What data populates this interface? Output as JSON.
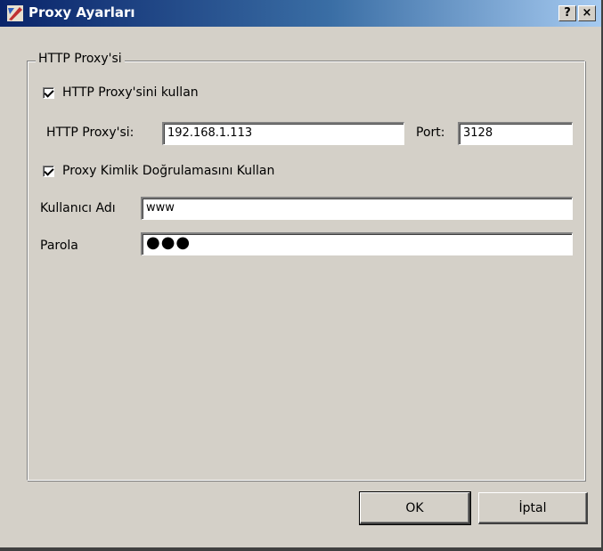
{
  "window": {
    "title": "Proxy Ayarları",
    "help_label": "?",
    "close_label": "×"
  },
  "group": {
    "legend": "HTTP Proxy'si"
  },
  "use_proxy": {
    "label": "HTTP Proxy'sini kullan",
    "checked": true
  },
  "proxy": {
    "host_label": "HTTP Proxy'si:",
    "host_value": "192.168.1.113",
    "port_label": "Port:",
    "port_value": "3128"
  },
  "use_auth": {
    "label": "Proxy Kimlik Doğrulamasını Kullan",
    "checked": true
  },
  "auth": {
    "username_label": "Kullanıcı Adı",
    "username_value": "www",
    "password_label": "Parola",
    "password_value": "●●●"
  },
  "buttons": {
    "ok_label": "OK",
    "cancel_label": "İptal"
  },
  "colors": {
    "dialog_bg": "#d4d0c8",
    "titlebar_start": "#0a246a",
    "titlebar_end": "#a6caf0"
  }
}
